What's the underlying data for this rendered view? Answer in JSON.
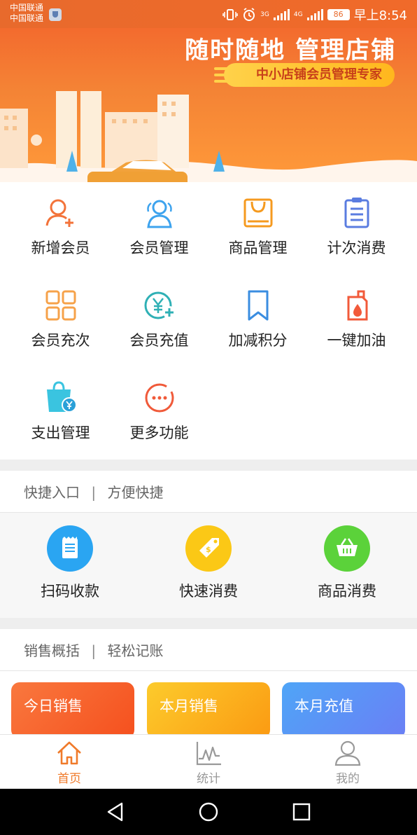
{
  "status": {
    "carrier1": "中国联通",
    "carrier2": "中国联通",
    "net1": "3G",
    "net2": "4G",
    "battery": "86",
    "time": "早上8:54"
  },
  "banner": {
    "title": "随时随地 管理店铺",
    "subtitle": "中小店铺会员管理专家"
  },
  "grid": [
    {
      "label": "新增会员",
      "icon": "add-member-icon"
    },
    {
      "label": "会员管理",
      "icon": "members-icon"
    },
    {
      "label": "商品管理",
      "icon": "product-bag-icon"
    },
    {
      "label": "计次消费",
      "icon": "clipboard-icon"
    },
    {
      "label": "会员充次",
      "icon": "four-squares-icon"
    },
    {
      "label": "会员充值",
      "icon": "yen-add-icon"
    },
    {
      "label": "加减积分",
      "icon": "bookmark-icon"
    },
    {
      "label": "一键加油",
      "icon": "fuel-can-icon"
    },
    {
      "label": "支出管理",
      "icon": "expense-bag-icon"
    },
    {
      "label": "更多功能",
      "icon": "more-icon"
    }
  ],
  "quick": {
    "header": "快捷入口",
    "header_sub": "方便快捷",
    "items": [
      {
        "label": "扫码收款",
        "icon": "scan-receipt-icon",
        "color": "#2aa5f2"
      },
      {
        "label": "快速消费",
        "icon": "price-tag-icon",
        "color": "#fbc816"
      },
      {
        "label": "商品消费",
        "icon": "basket-icon",
        "color": "#5bd23a"
      }
    ]
  },
  "sales": {
    "header": "销售概括",
    "header_sub": "轻松记账",
    "cards": [
      {
        "label": "今日销售",
        "color": "#f5632c"
      },
      {
        "label": "本月销售",
        "color": "#fcb018"
      },
      {
        "label": "本月充值",
        "color": "#5b8ff5"
      }
    ]
  },
  "tabs": [
    {
      "label": "首页",
      "icon": "home-icon",
      "active": true
    },
    {
      "label": "统计",
      "icon": "chart-icon",
      "active": false
    },
    {
      "label": "我的",
      "icon": "user-icon",
      "active": false
    }
  ],
  "sep": "|"
}
